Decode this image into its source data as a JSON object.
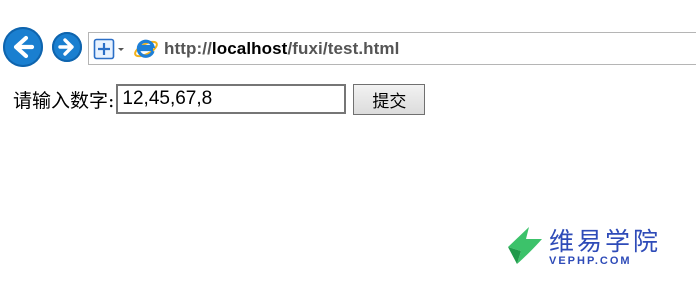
{
  "browser": {
    "url_prefix": "http://",
    "url_host": "localhost",
    "url_path": "/fuxi/test.html",
    "back_icon": "arrow-left-icon",
    "forward_icon": "arrow-right-icon",
    "accent_color": "#1a7fd0"
  },
  "form": {
    "label": "请输入数字:",
    "input_value": "12,45,67,8",
    "submit_label": "提交"
  },
  "watermark": {
    "cn_text": "维易学院",
    "en_text": "VEPHP.COM",
    "color": "#2e4bb8"
  }
}
